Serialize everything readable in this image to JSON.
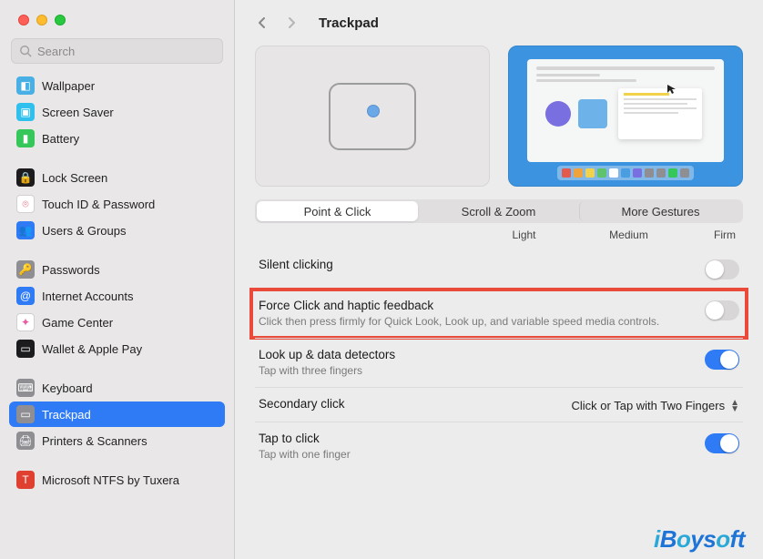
{
  "window": {
    "title": "Trackpad"
  },
  "search": {
    "placeholder": "Search"
  },
  "sidebar": {
    "items": [
      {
        "label": "Wallpaper",
        "icon_bg": "#48b0e4",
        "glyph": "◧"
      },
      {
        "label": "Screen Saver",
        "icon_bg": "#2fc0ed",
        "glyph": "▣"
      },
      {
        "label": "Battery",
        "icon_bg": "#35c759",
        "glyph": "▮"
      },
      {
        "gap": true
      },
      {
        "label": "Lock Screen",
        "icon_bg": "#1c1c1e",
        "glyph": "🔒"
      },
      {
        "label": "Touch ID & Password",
        "icon_bg": "#ffffff",
        "glyph": "⌾",
        "fg": "#e65a6a"
      },
      {
        "label": "Users & Groups",
        "icon_bg": "#2f7bf6",
        "glyph": "👥"
      },
      {
        "gap": true
      },
      {
        "label": "Passwords",
        "icon_bg": "#8e8e93",
        "glyph": "🔑"
      },
      {
        "label": "Internet Accounts",
        "icon_bg": "#2f7bf6",
        "glyph": "@"
      },
      {
        "label": "Game Center",
        "icon_bg": "#ffffff",
        "glyph": "✦",
        "fg": "#e85ca3"
      },
      {
        "label": "Wallet & Apple Pay",
        "icon_bg": "#1c1c1e",
        "glyph": "▭"
      },
      {
        "gap": true
      },
      {
        "label": "Keyboard",
        "icon_bg": "#8e8e93",
        "glyph": "⌨"
      },
      {
        "label": "Trackpad",
        "icon_bg": "#8e8e93",
        "glyph": "▭",
        "active": true
      },
      {
        "label": "Printers & Scanners",
        "icon_bg": "#8e8e93",
        "glyph": "🖨"
      },
      {
        "gap": true
      },
      {
        "label": "Microsoft NTFS by Tuxera",
        "icon_bg": "#e0402f",
        "glyph": "T"
      }
    ]
  },
  "tabs": [
    {
      "label": "Point & Click",
      "active": true
    },
    {
      "label": "Scroll & Zoom"
    },
    {
      "label": "More Gestures"
    }
  ],
  "scale": {
    "low": "Light",
    "mid": "Medium",
    "high": "Firm"
  },
  "settings": [
    {
      "key": "silent",
      "name": "Silent clicking",
      "type": "toggle",
      "value": false
    },
    {
      "key": "force",
      "name": "Force Click and haptic feedback",
      "sub": "Click then press firmly for Quick Look, Look up, and variable speed media controls.",
      "type": "toggle",
      "value": false,
      "highlight": true
    },
    {
      "key": "lookup",
      "name": "Look up & data detectors",
      "sub": "Tap with three fingers",
      "type": "toggle",
      "value": true
    },
    {
      "key": "secondary",
      "name": "Secondary click",
      "type": "select",
      "selected": "Click or Tap with Two Fingers"
    },
    {
      "key": "tap",
      "name": "Tap to click",
      "sub": "Tap with one finger",
      "type": "toggle",
      "value": true
    }
  ],
  "watermark": "iBoysoft"
}
